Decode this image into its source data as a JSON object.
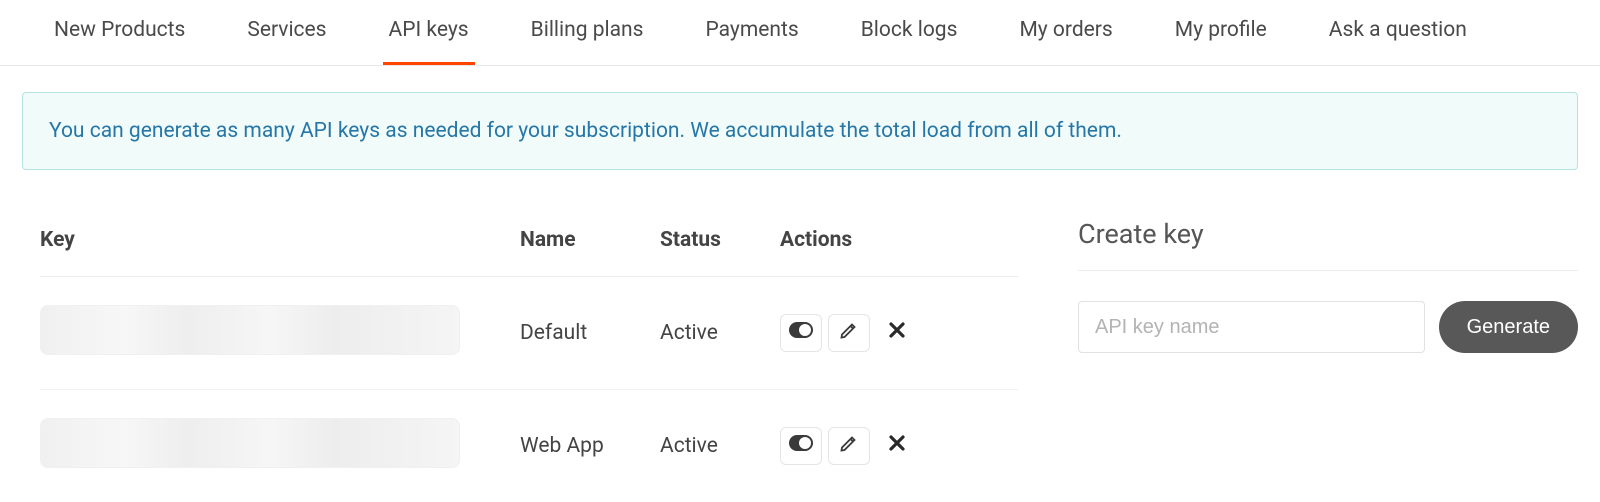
{
  "tabs": [
    {
      "label": "New Products",
      "active": false
    },
    {
      "label": "Services",
      "active": false
    },
    {
      "label": "API keys",
      "active": true
    },
    {
      "label": "Billing plans",
      "active": false
    },
    {
      "label": "Payments",
      "active": false
    },
    {
      "label": "Block logs",
      "active": false
    },
    {
      "label": "My orders",
      "active": false
    },
    {
      "label": "My profile",
      "active": false
    },
    {
      "label": "Ask a question",
      "active": false
    }
  ],
  "banner": {
    "text": "You can generate as many API keys as needed for your subscription. We accumulate the total load from all of them."
  },
  "table": {
    "headers": {
      "key": "Key",
      "name": "Name",
      "status": "Status",
      "actions": "Actions"
    },
    "rows": [
      {
        "name": "Default",
        "status": "Active"
      },
      {
        "name": "Web App",
        "status": "Active"
      }
    ]
  },
  "create": {
    "title": "Create key",
    "placeholder": "API key name",
    "button": "Generate"
  }
}
